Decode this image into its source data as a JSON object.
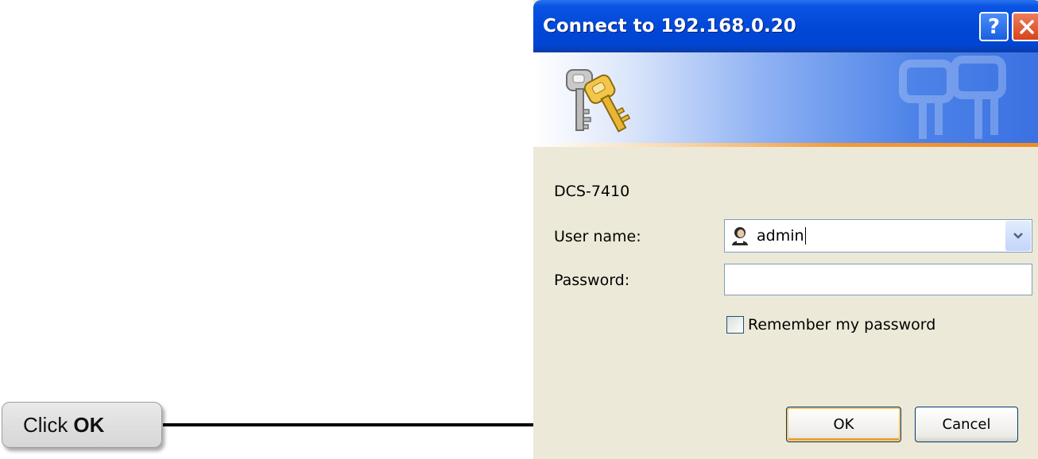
{
  "callout": {
    "text_prefix": "Click",
    "text_bold": "OK"
  },
  "dialog": {
    "title": "Connect to 192.168.0.20",
    "help_label": "?",
    "server_name": "DCS-7410",
    "username_label": "User name:",
    "username_value": "admin",
    "password_label": "Password:",
    "password_value": "",
    "remember_label": "Remember my password",
    "remember_checked": false,
    "ok_label": "OK",
    "cancel_label": "Cancel"
  },
  "icons": {
    "banner": "keys-icon",
    "user": "user-icon",
    "help": "help-icon",
    "close": "close-icon",
    "dropdown": "chevron-down-icon"
  },
  "colors": {
    "titlebar": "#0047d6",
    "dialog_bg": "#ece9d8",
    "accent_orange": "#f08a24"
  }
}
